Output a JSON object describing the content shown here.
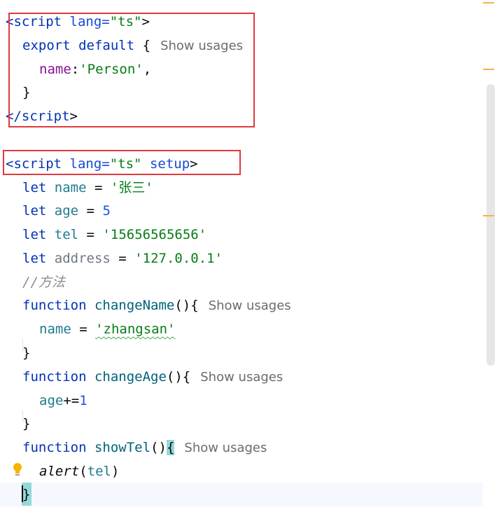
{
  "editor": {
    "block1": {
      "open_tag": "<script",
      "attr_name": "lang=",
      "attr_value": "\"ts\"",
      "open_tag_end": ">",
      "export_kw": "export",
      "default_kw": "default",
      "brace_open": "{",
      "hint": "Show usages",
      "prop": "name",
      "colon": ":",
      "prop_value": "'Person'",
      "comma": ",",
      "brace_close": "}",
      "close_tag": "</script",
      "close_tag_end": ">"
    },
    "block2": {
      "open_tag": "<script",
      "attr_name": "lang=",
      "attr_value": "\"ts\"",
      "setup_attr": "setup",
      "open_tag_end": ">",
      "let_kw": "let",
      "vars": [
        {
          "name": "name",
          "eq": " = ",
          "value": "'张三'"
        },
        {
          "name": "age",
          "eq": " = ",
          "value": "5"
        },
        {
          "name": "tel",
          "eq": " = ",
          "value": "'15656565656'"
        },
        {
          "name": "address",
          "eq": " = ",
          "value": "'127.0.0.1'"
        }
      ],
      "comment": "//方法",
      "function_kw": "function",
      "functions": [
        {
          "name": "changeName",
          "parens": "(){",
          "hint": "Show usages",
          "body_var": "name",
          "body_op": " = ",
          "body_value": "'zhangsan'",
          "close": "}"
        },
        {
          "name": "changeAge",
          "parens": "(){",
          "hint": "Show usages",
          "body_var": "age",
          "body_op": "+=",
          "body_value": "1",
          "close": "}"
        },
        {
          "name": "showTel",
          "parens": "()",
          "brace": "{",
          "hint": "Show usages",
          "call": "alert",
          "call_open": "(",
          "call_arg": "tel",
          "call_close": ")",
          "close": "}"
        }
      ]
    }
  },
  "colors": {
    "annotation_box": "#e0393e",
    "brace_match": "#93d9d9",
    "scroll_marker": "#f0b44a"
  }
}
